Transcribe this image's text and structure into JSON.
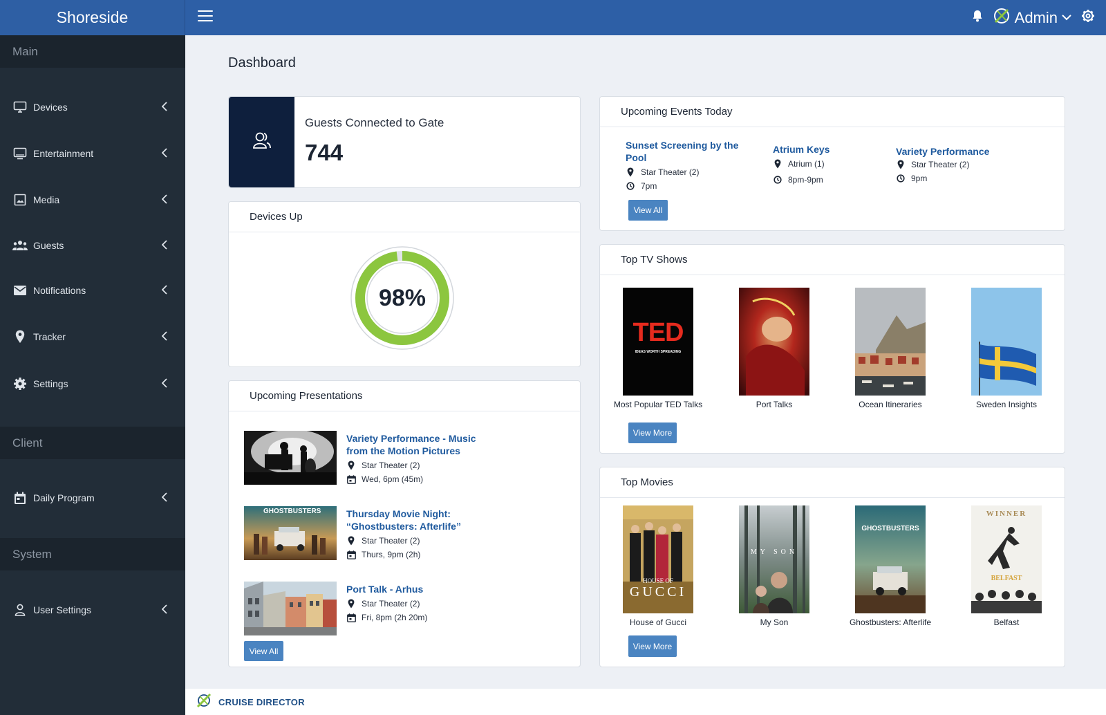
{
  "app": {
    "brand": "Shoreside",
    "user": "Admin"
  },
  "colors": {
    "accent": "#2d5fa6",
    "sidebar": "#222d38",
    "gauge": "#8cc63f",
    "link": "#1f5a9e",
    "button": "#4a84c1"
  },
  "sidebar": {
    "sections": [
      "Main",
      "Client",
      "System"
    ],
    "items": [
      {
        "label": "Devices",
        "icon": "monitor-icon"
      },
      {
        "label": "Entertainment",
        "icon": "tv-icon"
      },
      {
        "label": "Media",
        "icon": "image-icon"
      },
      {
        "label": "Guests",
        "icon": "group-icon"
      },
      {
        "label": "Notifications",
        "icon": "mail-icon"
      },
      {
        "label": "Tracker",
        "icon": "map-pin-icon"
      },
      {
        "label": "Settings",
        "icon": "gear-icon"
      },
      {
        "label": "Daily Program",
        "icon": "calendar-icon"
      },
      {
        "label": "User Settings",
        "icon": "user-icon"
      }
    ]
  },
  "page": {
    "title": "Dashboard"
  },
  "guests": {
    "label": "Guests Connected to Gate",
    "value": "744"
  },
  "devices": {
    "title": "Devices Up",
    "percent": 98,
    "percent_label": "98%"
  },
  "presentations": {
    "title": "Upcoming Presentations",
    "items": [
      {
        "title": "Variety Performance - Music from the Motion Pictures",
        "location": "Star Theater (2)",
        "when": "Wed, 6pm (45m)"
      },
      {
        "title": "Thursday Movie Night: “Ghostbusters: Afterlife”",
        "location": "Star Theater (2)",
        "when": "Thurs, 9pm (2h)"
      },
      {
        "title": "Port Talk - Arhus",
        "location": "Star Theater (2)",
        "when": "Fri, 8pm (2h 20m)"
      }
    ],
    "button": "View All"
  },
  "events": {
    "title": "Upcoming Events Today",
    "items": [
      {
        "title": "Sunset Screening by the Pool",
        "location": "Star Theater (2)",
        "time": "7pm"
      },
      {
        "title": "Atrium Keys",
        "location": "Atrium (1)",
        "time": "8pm-9pm"
      },
      {
        "title": "Variety Performance",
        "location": "Star Theater (2)",
        "time": "9pm"
      }
    ],
    "button": "View All"
  },
  "tv": {
    "title": "Top TV Shows",
    "items": [
      "Most Popular TED Talks",
      "Port Talks",
      "Ocean Itineraries",
      "Sweden Insights"
    ],
    "ted_logo": "TED",
    "ted_tag": "IDEAS WORTH SPREADING",
    "button": "View More"
  },
  "movies": {
    "title": "Top Movies",
    "items": [
      "House of Gucci",
      "My Son",
      "Ghostbusters: Afterlife",
      "Belfast"
    ],
    "poster_text": {
      "gucci": "GUCCI",
      "gucci_top": "HOUSE OF",
      "myson": "MY SON",
      "ghost": "GHOSTBUSTERS",
      "winner": "WINNER",
      "belfast": "BELFAST"
    },
    "button": "View More"
  },
  "footer": {
    "label": "CRUISE DIRECTOR"
  }
}
